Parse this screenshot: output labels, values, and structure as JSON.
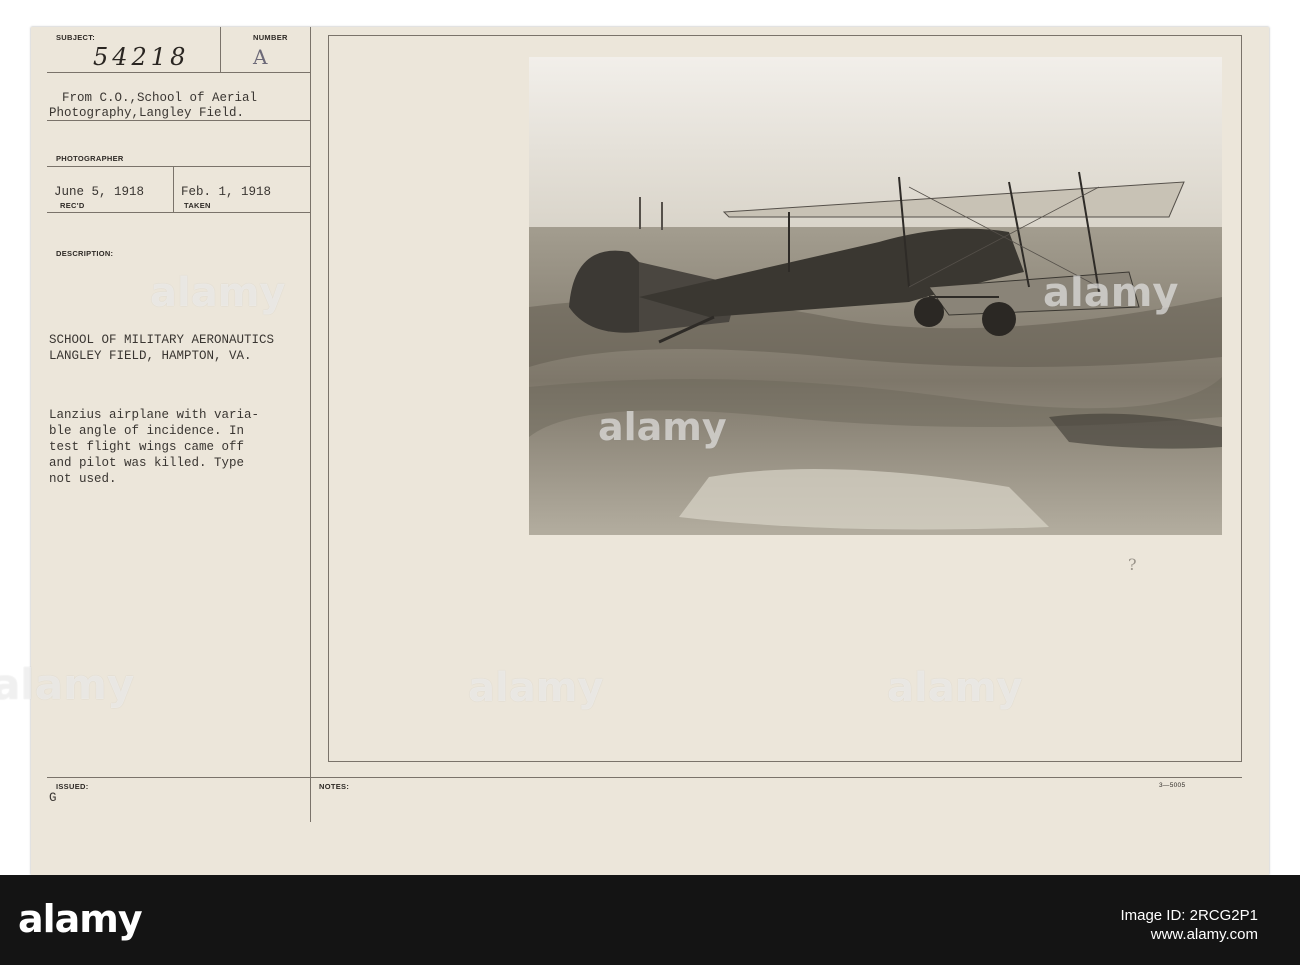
{
  "record": {
    "subject_label": "SUBJECT:",
    "subject_number": "54218",
    "number_label": "NUMBER",
    "number_value": "A",
    "from_line1": "From C.O.,School of Aerial",
    "from_line2": "Photography,Langley Field.",
    "photographer_label": "PHOTOGRAPHER",
    "recd_date": "June 5, 1918",
    "recd_label": "REC'D",
    "taken_date": "Feb. 1, 1918",
    "taken_label": "TAKEN",
    "description_label": "DESCRIPTION:",
    "description_heading_line1": "SCHOOL OF MILITARY AERONAUTICS",
    "description_heading_line2": "LANGLEY FIELD, HAMPTON, VA.",
    "description_body": [
      "Lanzius airplane with varia-",
      "ble angle of incidence. In",
      "test flight wings came off",
      "and pilot was killed. Type",
      "not used."
    ],
    "issued_label": "ISSUED:",
    "issued_value": "G",
    "notes_label": "NOTES:",
    "form_code": "3—5005",
    "pencil_mark": "?"
  },
  "watermark": {
    "text": "alamy"
  },
  "footer": {
    "logo": "alamy",
    "image_id": "Image ID: 2RCG2P1",
    "url": "www.alamy.com"
  }
}
